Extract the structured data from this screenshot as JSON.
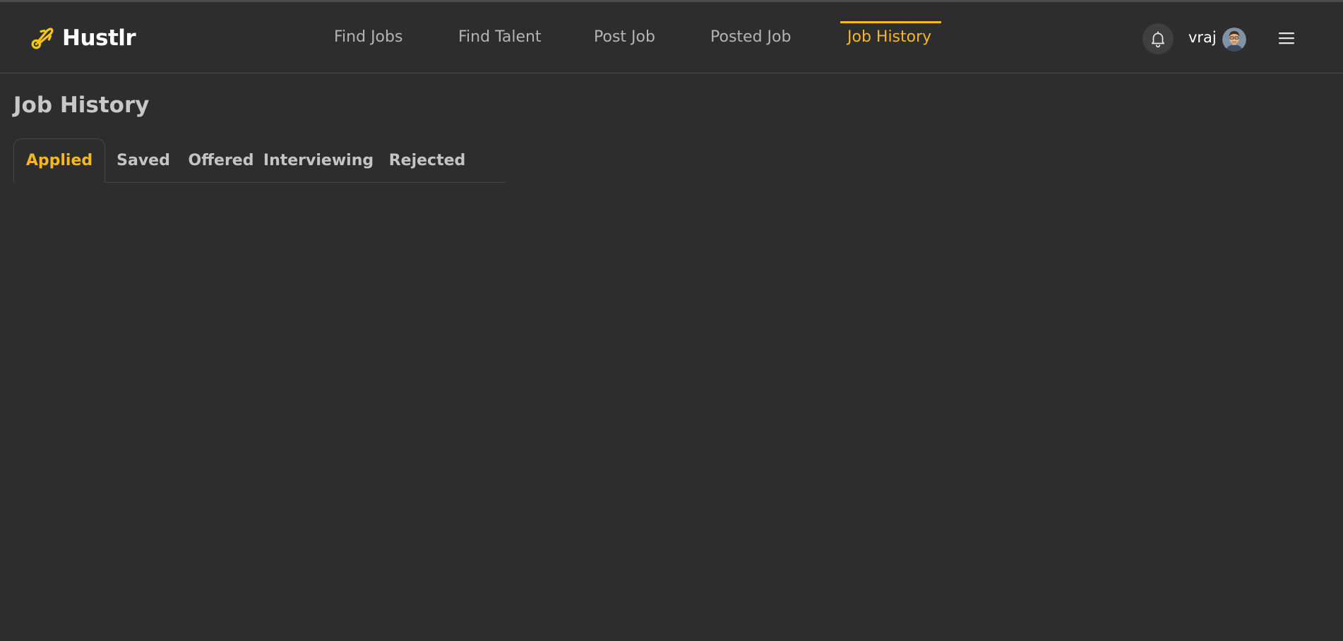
{
  "app": {
    "name": "Hustlr",
    "logo_icon": "rocket-icon",
    "accent_color": "#f5b820",
    "background_color": "#2d2d2d"
  },
  "nav": {
    "items": [
      {
        "label": "Find Jobs",
        "active": false
      },
      {
        "label": "Find Talent",
        "active": false
      },
      {
        "label": "Post Job",
        "active": false
      },
      {
        "label": "Posted Job",
        "active": false
      },
      {
        "label": "Job History",
        "active": true
      }
    ]
  },
  "header_right": {
    "notification_icon": "bell-icon",
    "user_name": "vraj",
    "avatar_icon": "avatar",
    "menu_icon": "hamburger-menu-icon"
  },
  "page": {
    "title": "Job History",
    "tabs": [
      {
        "label": "Applied",
        "active": true
      },
      {
        "label": "Saved",
        "active": false
      },
      {
        "label": "Offered",
        "active": false
      },
      {
        "label": "Interviewing",
        "active": false
      },
      {
        "label": "Rejected",
        "active": false
      }
    ]
  }
}
